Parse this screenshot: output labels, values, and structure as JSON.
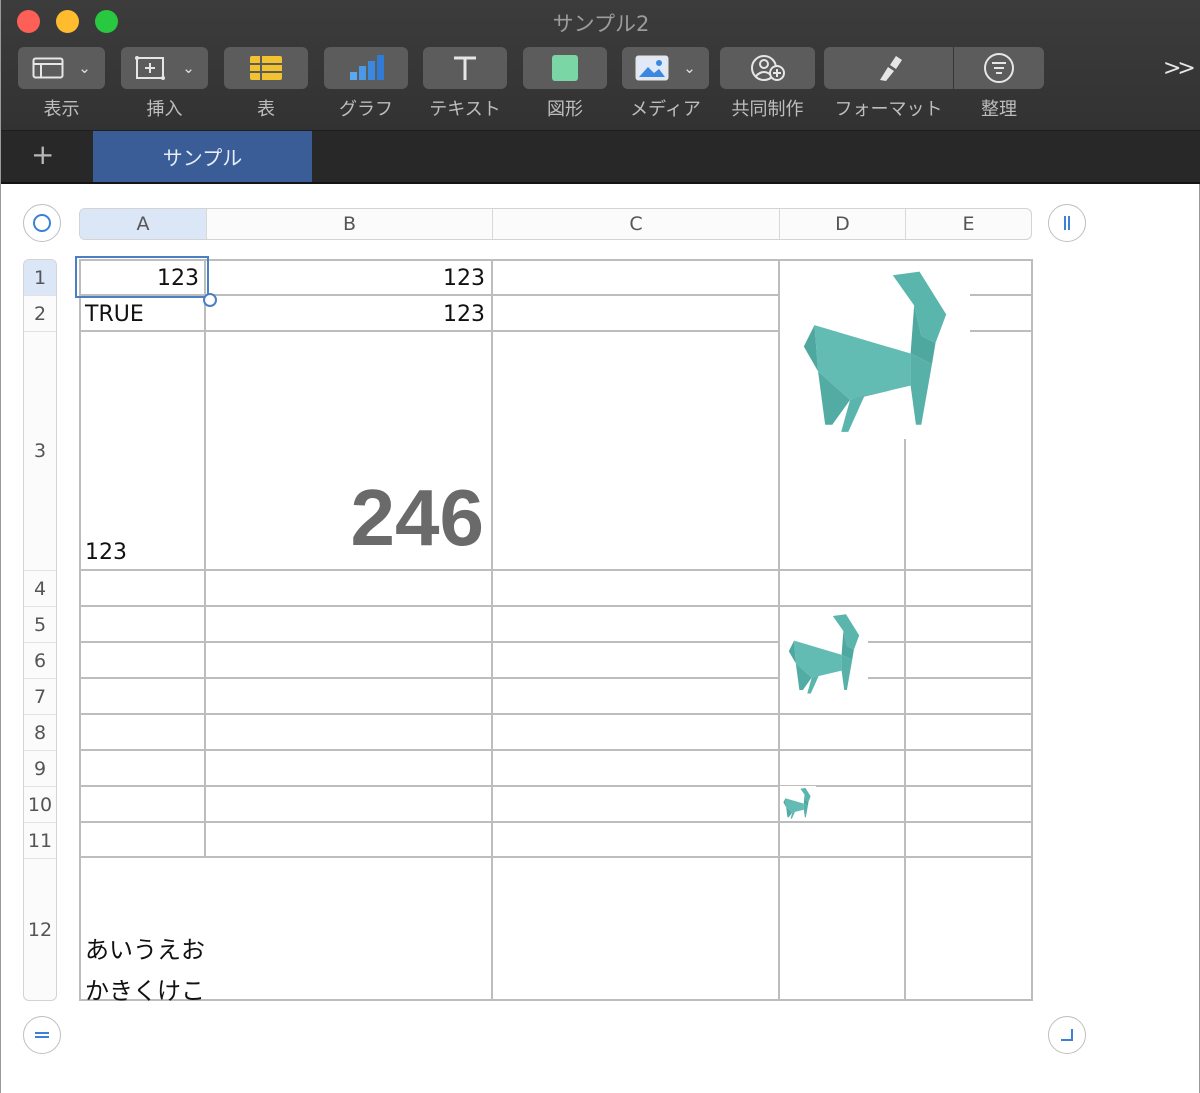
{
  "window": {
    "title": "サンプル2"
  },
  "toolbar": {
    "items": [
      {
        "label": "表示",
        "icon": "view-icon"
      },
      {
        "label": "挿入",
        "icon": "insert-icon"
      },
      {
        "label": "表",
        "icon": "table-icon"
      },
      {
        "label": "グラフ",
        "icon": "chart-icon"
      },
      {
        "label": "テキスト",
        "icon": "text-icon"
      },
      {
        "label": "図形",
        "icon": "shape-icon"
      },
      {
        "label": "メディア",
        "icon": "media-icon"
      },
      {
        "label": "共同制作",
        "icon": "collaborate-icon"
      },
      {
        "label": "フォーマット",
        "icon": "format-brush-icon"
      },
      {
        "label": "整理",
        "icon": "organize-icon"
      }
    ],
    "overflow": ">>"
  },
  "sheets": {
    "add": "+",
    "active": "サンプル"
  },
  "columns": [
    "A",
    "B",
    "C",
    "D",
    "E"
  ],
  "rows": [
    "1",
    "2",
    "3",
    "4",
    "5",
    "6",
    "7",
    "8",
    "9",
    "10",
    "11",
    "12"
  ],
  "cells": {
    "a1": "123",
    "b1": "123",
    "a2": "TRUE",
    "b2": "123",
    "a3": "123",
    "b3": "246",
    "a12_line1": "あいうえお",
    "a12_line2": "かきくけこ"
  },
  "images": {
    "icon": "goat-origami-icon",
    "color": "#5ab5ad"
  },
  "colors": {
    "accent": "#3a5d98",
    "selection": "#4a7fc4",
    "bigtext": "#6a6a6a"
  }
}
